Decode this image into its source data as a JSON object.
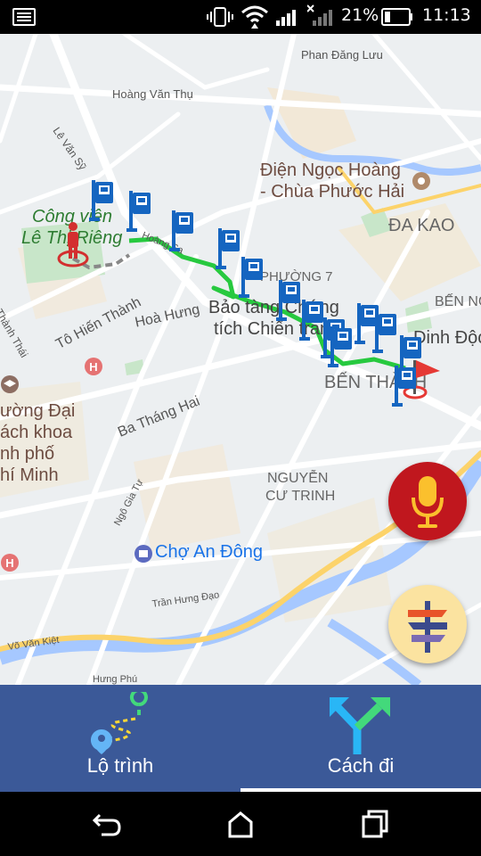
{
  "status_bar": {
    "battery_percent": "21%",
    "time": "11:13",
    "icons": [
      "notification-icon",
      "vibrate-icon",
      "wifi-icon",
      "signal-icon",
      "no-sim-signal-icon",
      "battery-icon"
    ]
  },
  "map": {
    "labels": {
      "phan_dang_luu": "Phan Đăng Lưu",
      "hoang_van_thu": "Hoàng Văn Thụ",
      "le_van_sy": "Lê Văn Sỹ",
      "dien_ngoc_hoang_1": "Điện Ngọc Hoàng",
      "dien_ngoc_hoang_2": "- Chùa Phước Hải",
      "da_kao": "ĐA KAO",
      "cong_vien_1": "Công viên",
      "cong_vien_2": "Lê Thị Riêng",
      "hoang_sa": "Hoàng Sa",
      "phuong_7": "PHƯỜNG 7",
      "bao_tang_1": "Bảo tàng Chứng",
      "bao_tang_2": "tích Chiến tranh",
      "ben_nghe": "BẾN NG",
      "dinh_doc_lap": "Dinh Độc",
      "thanh_thai": "Thành Thái",
      "to_hien_thanh": "Tô Hiến Thành",
      "hoa_hung": "Hoà Hưng",
      "ben_thanh": "BẾN THÀNH",
      "ba_thang_hai": "Ba Tháng Hai",
      "truong_dai_1": "ường Đại",
      "truong_dai_2": "ách khoa",
      "truong_dai_3": "nh phố",
      "truong_dai_4": "hí Minh",
      "nguyen_cu_trinh_1": "NGUYỄN",
      "nguyen_cu_trinh_2": "CƯ TRINH",
      "ngo_gia_tu": "Ngô Gia Tự",
      "cho_an_dong": "Chợ An Đông",
      "tran_hung_dao": "Trần Hưng Đạo",
      "vo_van_kiet": "Võ Văn Kiệt",
      "hung_phu": "Hưng Phú"
    },
    "route_color": "#27c93f",
    "bus_stop_color": "#1565c0",
    "start_marker_color": "#d32f2f",
    "end_flag_color": "#e53935"
  },
  "fabs": {
    "voice_icon": "microphone-icon",
    "directions_icon": "signpost-icon"
  },
  "bottom_nav": {
    "tabs": [
      {
        "label": "Lộ trình",
        "icon": "route-icon",
        "active": false
      },
      {
        "label": "Cách đi",
        "icon": "fork-arrows-icon",
        "active": true
      }
    ],
    "background": "#3b5998"
  },
  "system_nav": {
    "back_icon": "back-icon",
    "home_icon": "home-icon",
    "recents_icon": "recents-icon"
  }
}
